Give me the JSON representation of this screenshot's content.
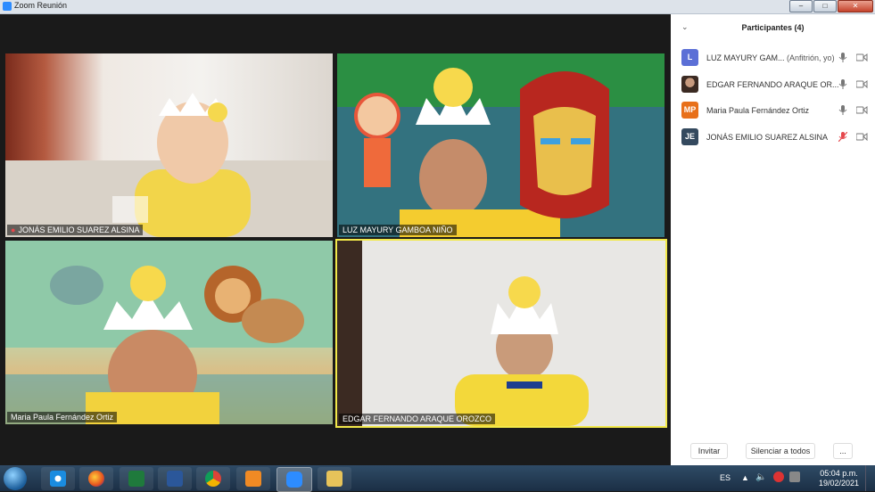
{
  "window": {
    "title": "Zoom Reunión"
  },
  "tiles": [
    {
      "name": "JONÁS EMILIO SUAREZ ALSINA",
      "muted": true
    },
    {
      "name": "LUZ MAYURY GAMBOA NIÑO",
      "muted": false
    },
    {
      "name": "Maria Paula Fernández Ortiz",
      "muted": false
    },
    {
      "name": "EDGAR FERNANDO ARAQUE OROZCO",
      "muted": false,
      "active_speaker": true
    }
  ],
  "participants_panel": {
    "title": "Participantes (4)",
    "participants": [
      {
        "avatar": "L",
        "avatar_color": "#5b6fd6",
        "name": "LUZ MAYURY GAM...",
        "role": "(Anfitrión, yo)",
        "mic": "on"
      },
      {
        "avatar": "",
        "avatar_color": "#6b4a3a",
        "name": "EDGAR FERNANDO ARAQUE OR...",
        "role": "",
        "mic": "on"
      },
      {
        "avatar": "MP",
        "avatar_color": "#e8701a",
        "name": "Maria Paula Fernández Ortiz",
        "role": "",
        "mic": "on"
      },
      {
        "avatar": "JE",
        "avatar_color": "#34495e",
        "name": "JONÁS EMILIO SUAREZ ALSINA",
        "role": "",
        "mic": "muted"
      }
    ],
    "buttons": {
      "invite": "Invitar",
      "mute_all": "Silenciar a todos",
      "more": "..."
    }
  },
  "taskbar": {
    "apps": [
      "internet-explorer-icon",
      "firefox-icon",
      "excel-icon",
      "word-icon",
      "chrome-icon",
      "media-player-icon",
      "zoom-icon",
      "file-explorer-icon"
    ],
    "language": "ES",
    "time": "05:04 p.m.",
    "date": "19/02/2021"
  },
  "colors": {
    "accent": "#2d8cff",
    "active_speaker_border": "#f2e94a",
    "muted": "#e5484d"
  }
}
